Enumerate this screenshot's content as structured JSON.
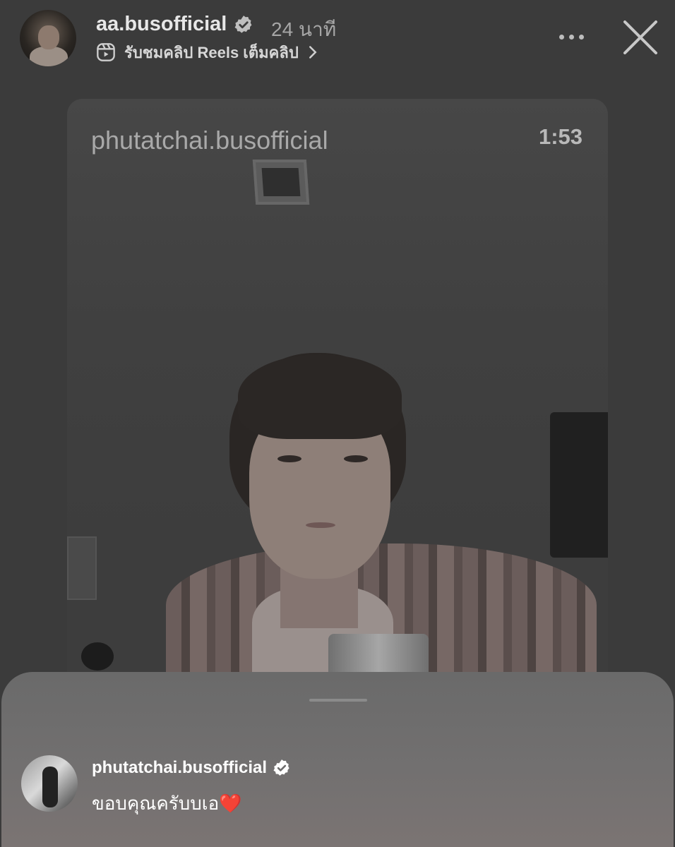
{
  "header": {
    "username": "aa.busofficial",
    "time": "24 นาที",
    "reels_link": "รับชมคลิป Reels เต็มคลิป",
    "icons": [
      "verified-badge-icon",
      "reels-icon",
      "chevron-right-icon",
      "more-icon",
      "close-icon"
    ]
  },
  "video": {
    "watermark_username": "phutatchai.busofficial",
    "duration": "1:53"
  },
  "reply": {
    "username": "phutatchai.busofficial",
    "message": "ขอบคุณครับบเอ",
    "emoji": "❤️"
  },
  "colors": {
    "background": "#3b3b3b",
    "sheet": "#6e6d6d",
    "heart": "#e0242b"
  }
}
